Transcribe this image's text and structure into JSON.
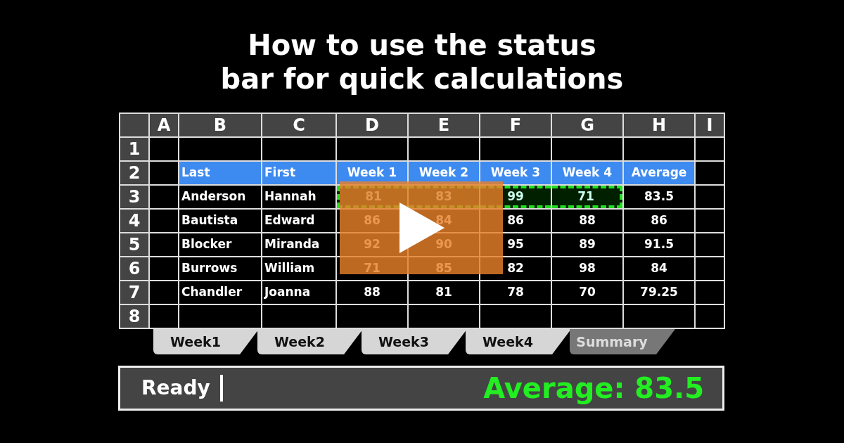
{
  "title_lines": [
    "How to use the status",
    "bar for quick calculations"
  ],
  "columns": [
    "A",
    "B",
    "C",
    "D",
    "E",
    "F",
    "G",
    "H",
    "I"
  ],
  "rows": [
    {
      "number": "1",
      "kind": "data",
      "cells": [
        {
          "selected": false
        },
        {
          "selected": false
        },
        {
          "selected": false
        },
        {
          "selected": false
        },
        {
          "selected": false
        },
        {
          "selected": false
        },
        {
          "selected": false
        },
        {
          "selected": false
        },
        {
          "selected": false
        }
      ]
    },
    {
      "number": "2",
      "kind": "header",
      "cells": [
        {
          "selected": false
        },
        {
          "text": "Last",
          "selected": false
        },
        {
          "text": "First",
          "selected": false
        },
        {
          "text": "Week 1",
          "selected": false
        },
        {
          "text": "Week 2",
          "selected": false
        },
        {
          "text": "Week 3",
          "selected": false
        },
        {
          "text": "Week 4",
          "selected": false
        },
        {
          "text": "Average",
          "selected": false
        },
        {
          "selected": false
        }
      ]
    },
    {
      "number": "3",
      "kind": "data",
      "cells": [
        {
          "selected": false
        },
        {
          "text": "Anderson",
          "selected": false
        },
        {
          "text": "Hannah",
          "selected": false
        },
        {
          "text": "81",
          "selected": true
        },
        {
          "text": "83",
          "selected": true
        },
        {
          "text": "99",
          "selected": true
        },
        {
          "text": "71",
          "selected": true
        },
        {
          "text": "83.5",
          "selected": false
        },
        {
          "selected": false
        }
      ]
    },
    {
      "number": "4",
      "kind": "data",
      "cells": [
        {
          "selected": false
        },
        {
          "text": "Bautista",
          "selected": false
        },
        {
          "text": "Edward",
          "selected": false
        },
        {
          "text": "86",
          "selected": false
        },
        {
          "text": "84",
          "selected": false
        },
        {
          "text": "86",
          "selected": false
        },
        {
          "text": "88",
          "selected": false
        },
        {
          "text": "86",
          "selected": false
        },
        {
          "selected": false
        }
      ]
    },
    {
      "number": "5",
      "kind": "data",
      "cells": [
        {
          "selected": false
        },
        {
          "text": "Blocker",
          "selected": false
        },
        {
          "text": "Miranda",
          "selected": false
        },
        {
          "text": "92",
          "selected": false
        },
        {
          "text": "90",
          "selected": false
        },
        {
          "text": "95",
          "selected": false
        },
        {
          "text": "89",
          "selected": false
        },
        {
          "text": "91.5",
          "selected": false
        },
        {
          "selected": false
        }
      ]
    },
    {
      "number": "6",
      "kind": "data",
      "cells": [
        {
          "selected": false
        },
        {
          "text": "Burrows",
          "selected": false
        },
        {
          "text": "William",
          "selected": false
        },
        {
          "text": "71",
          "selected": false
        },
        {
          "text": "85",
          "selected": false
        },
        {
          "text": "82",
          "selected": false
        },
        {
          "text": "98",
          "selected": false
        },
        {
          "text": "84",
          "selected": false
        },
        {
          "selected": false
        }
      ]
    },
    {
      "number": "7",
      "kind": "data",
      "cells": [
        {
          "selected": false
        },
        {
          "text": "Chandler",
          "selected": false
        },
        {
          "text": "Joanna",
          "selected": false
        },
        {
          "text": "88",
          "selected": false
        },
        {
          "text": "81",
          "selected": false
        },
        {
          "text": "78",
          "selected": false
        },
        {
          "text": "70",
          "selected": false
        },
        {
          "text": "79.25",
          "selected": false
        },
        {
          "selected": false
        }
      ]
    },
    {
      "number": "8",
      "kind": "data",
      "cells": [
        {
          "selected": false
        },
        {
          "selected": false
        },
        {
          "selected": false
        },
        {
          "selected": false
        },
        {
          "selected": false
        },
        {
          "selected": false
        },
        {
          "selected": false
        },
        {
          "selected": false
        },
        {
          "selected": false
        }
      ]
    }
  ],
  "sheet_tabs": [
    {
      "label": "Week1",
      "selected": false
    },
    {
      "label": "Week2",
      "selected": false
    },
    {
      "label": "Week3",
      "selected": false
    },
    {
      "label": "Week4",
      "selected": false
    },
    {
      "label": "Summary",
      "selected": true
    }
  ],
  "status_bar": {
    "mode": "Ready",
    "summary": "Average: 83.5"
  }
}
